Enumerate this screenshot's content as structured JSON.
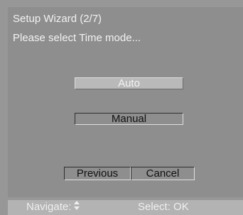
{
  "wizard": {
    "title": "Setup Wizard (2/7)",
    "prompt": "Please select Time mode..."
  },
  "options": [
    {
      "label": "Auto",
      "selected": true
    },
    {
      "label": "Manual",
      "selected": false
    }
  ],
  "buttons": {
    "previous": "Previous",
    "cancel": "Cancel"
  },
  "status": {
    "navigate_label": "Navigate:",
    "navigate_icon": "up-down-arrows-icon",
    "select_hint": "Select: OK"
  },
  "colors": {
    "background": "#979797",
    "panel": "#8e8e8e",
    "highlight": "#b9b9b9",
    "text_light": "#f2f2f2",
    "text_dark": "#111111"
  }
}
